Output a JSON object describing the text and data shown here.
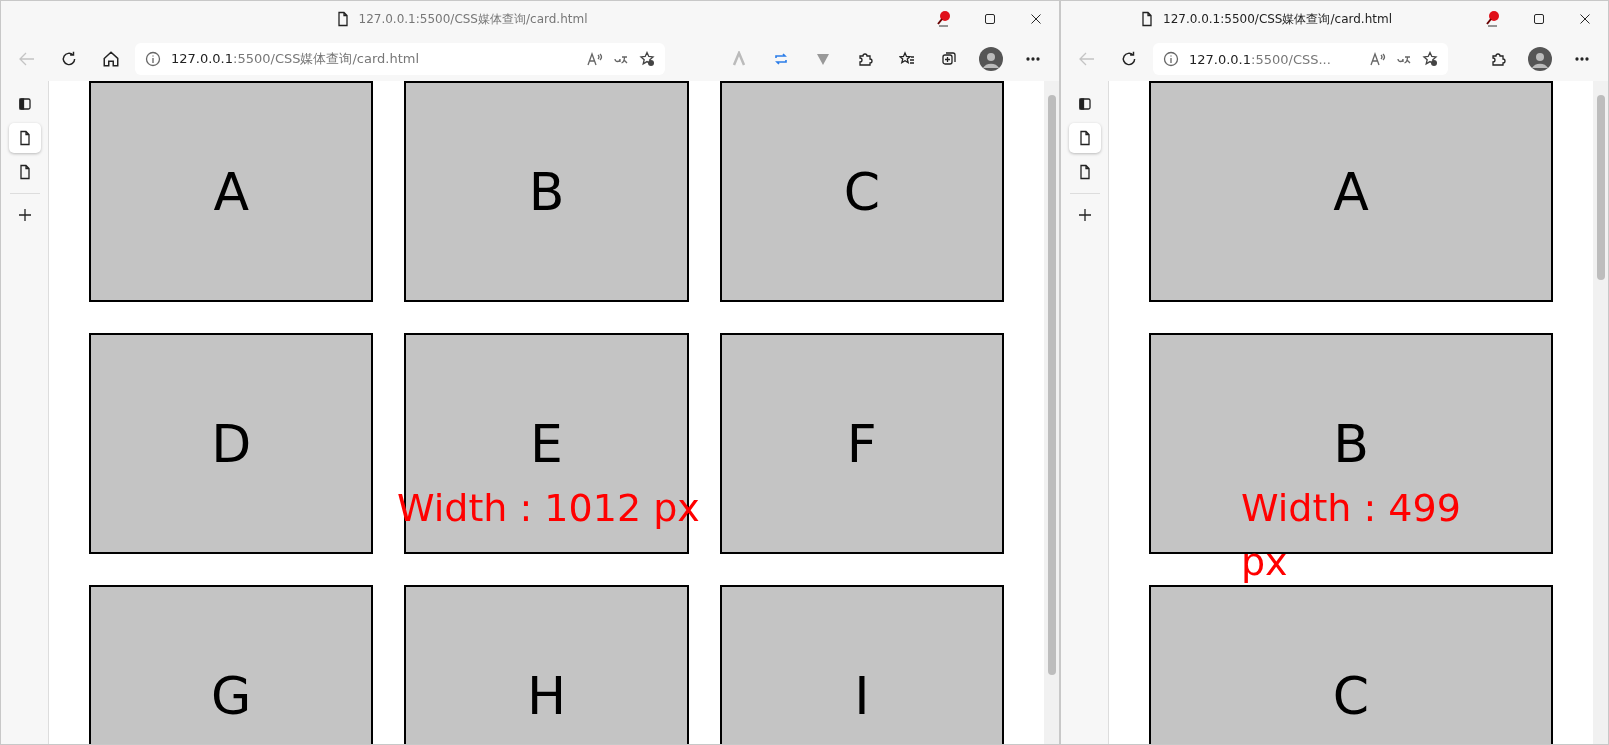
{
  "windows": [
    {
      "kind": "wide",
      "title": "127.0.0.1:5500/CSS媒体查询/card.html",
      "back_disabled": true,
      "url_host": "127.0.0.1",
      "url_rest": ":5500/CSS媒体查询/card.html",
      "vertical_tabs": [
        {
          "kind": "actions",
          "selected": false
        },
        {
          "kind": "page",
          "selected": true
        },
        {
          "kind": "page",
          "selected": false
        },
        {
          "kind": "new",
          "selected": false
        }
      ],
      "cards": [
        "A",
        "B",
        "C",
        "D",
        "E",
        "F",
        "G",
        "H",
        "I"
      ],
      "width_label": "Width : 1012 px"
    },
    {
      "kind": "narrow",
      "title": "127.0.0.1:5500/CSS媒体查询/card.html",
      "back_disabled": true,
      "url_host": "127.0.0.1",
      "url_rest": ":5500/CSS...",
      "vertical_tabs": [
        {
          "kind": "actions",
          "selected": false
        },
        {
          "kind": "page",
          "selected": true
        },
        {
          "kind": "page",
          "selected": false
        },
        {
          "kind": "new",
          "selected": false
        }
      ],
      "cards": [
        "A",
        "B",
        "C"
      ],
      "width_label": "Width : 499 px"
    }
  ]
}
